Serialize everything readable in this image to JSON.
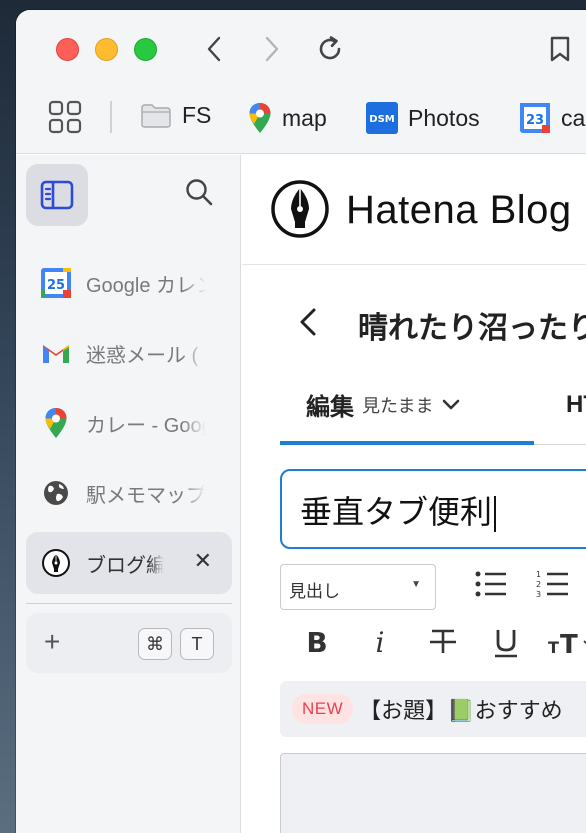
{
  "bookmarks": [
    {
      "label": "FS",
      "icon": "folder-icon"
    },
    {
      "label": "map",
      "icon": "google-maps-icon"
    },
    {
      "label": "Photos",
      "icon": "dsm-photos-icon",
      "badge": "DSM"
    },
    {
      "label": "ca",
      "icon": "google-calendar-icon",
      "badge": "23"
    }
  ],
  "sidebar": {
    "tabs": [
      {
        "title": "Google カレンダー",
        "icon": "google-calendar-icon",
        "badge": "25"
      },
      {
        "title": "迷惑メール (",
        "icon": "gmail-icon"
      },
      {
        "title": "カレー - Google マップ",
        "icon": "google-maps-icon"
      },
      {
        "title": "駅メモマップ",
        "icon": "globe-icon"
      },
      {
        "title": "ブログ編集",
        "icon": "hatena-pen-icon",
        "close": "✕"
      }
    ],
    "new_tab_label": "+",
    "shortcut": [
      "⌘",
      "T"
    ]
  },
  "page": {
    "brand": "Hatena Blog",
    "blog_title": "晴れたり沼ったり",
    "edit_tab_label": "編集",
    "edit_mode_label": "見たまま",
    "html_tab_label": "HTML",
    "title_value": "垂直タブ便利",
    "heading_select_value": "見出し",
    "announcement_badge": "NEW",
    "announcement_text": "【お題】📗おすすめ"
  },
  "colors": {
    "accent": "#1c7ed6",
    "new_badge_bg": "#ffe3e3",
    "new_badge_text": "#e8414f",
    "traffic_red": "#fe5f57",
    "traffic_yellow": "#febc2e",
    "traffic_green": "#28c840"
  }
}
